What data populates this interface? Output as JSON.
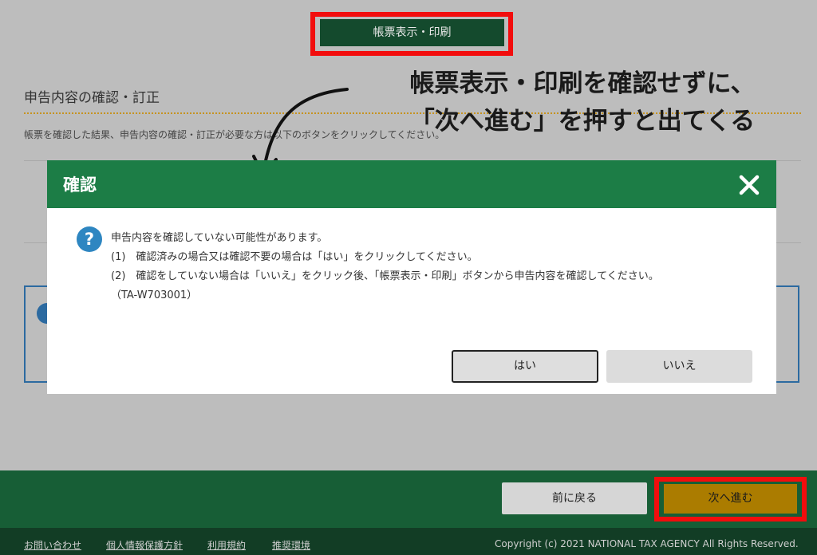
{
  "header": {
    "print_button": "帳票表示・印刷"
  },
  "section": {
    "title": "申告内容の確認・訂正",
    "description": "帳票を確認した結果、申告内容の確認・訂正が必要な方は以下のボタンをクリックしてください。"
  },
  "annotation": {
    "line1": "帳票表示・印刷を確認せずに、",
    "line2": "「次へ進む」を押すと出てくる",
    "highlight_color": "#f20d0d"
  },
  "dialog": {
    "title": "確認",
    "close_icon": "close-icon",
    "question_icon": "question-icon",
    "message": "申告内容を確認していない可能性があります。",
    "item1": "(1)　確認済みの場合又は確認不要の場合は「はい」をクリックしてください。",
    "item2": "(2)　確認をしていない場合は「いいえ」をクリック後、「帳票表示・印刷」ボタンから申告内容を確認してください。",
    "code": "（TA-W703001）",
    "yes_label": "はい",
    "no_label": "いいえ"
  },
  "footer": {
    "back_label": "前に戻る",
    "next_label": "次へ進む",
    "links": [
      "お問い合わせ",
      "個人情報保護方針",
      "利用規約",
      "推奨環境"
    ],
    "copyright": "Copyright (c) 2021 NATIONAL TAX AGENCY All Rights Reserved."
  },
  "colors": {
    "header_green": "#1c7d46",
    "footer_green": "#175e36",
    "next_gold": "#ab7c00"
  }
}
